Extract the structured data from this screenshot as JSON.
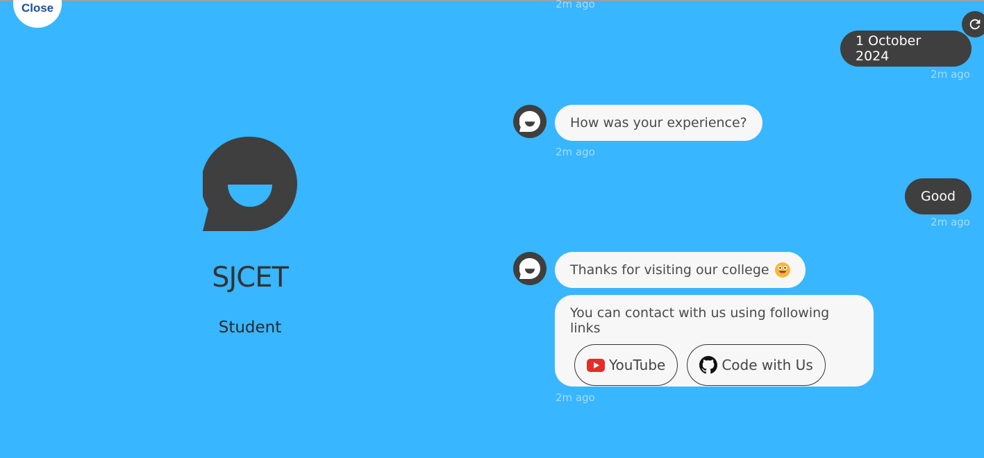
{
  "close_label": "Close",
  "profile": {
    "name": "SJCET",
    "subtitle": "Student"
  },
  "messages": {
    "top_timestamp": "2m ago",
    "user_date": "1 October 2024",
    "user_date_time": "2m ago",
    "bot_question": "How was your experience?",
    "bot_question_time": "2m ago",
    "user_answer": "Good",
    "user_answer_time": "2m ago",
    "bot_thanks": "Thanks for visiting our college",
    "bot_contact": "You can contact with us using following links",
    "bot_contact_time": "2m ago"
  },
  "links": [
    {
      "label": "YouTube",
      "icon": "youtube-icon"
    },
    {
      "label": "Code with Us",
      "icon": "github-icon"
    }
  ],
  "colors": {
    "background": "#38b6ff",
    "dark": "#3f3f3f",
    "bubble": "#f7f7f7",
    "youtube": "#e52d27"
  }
}
